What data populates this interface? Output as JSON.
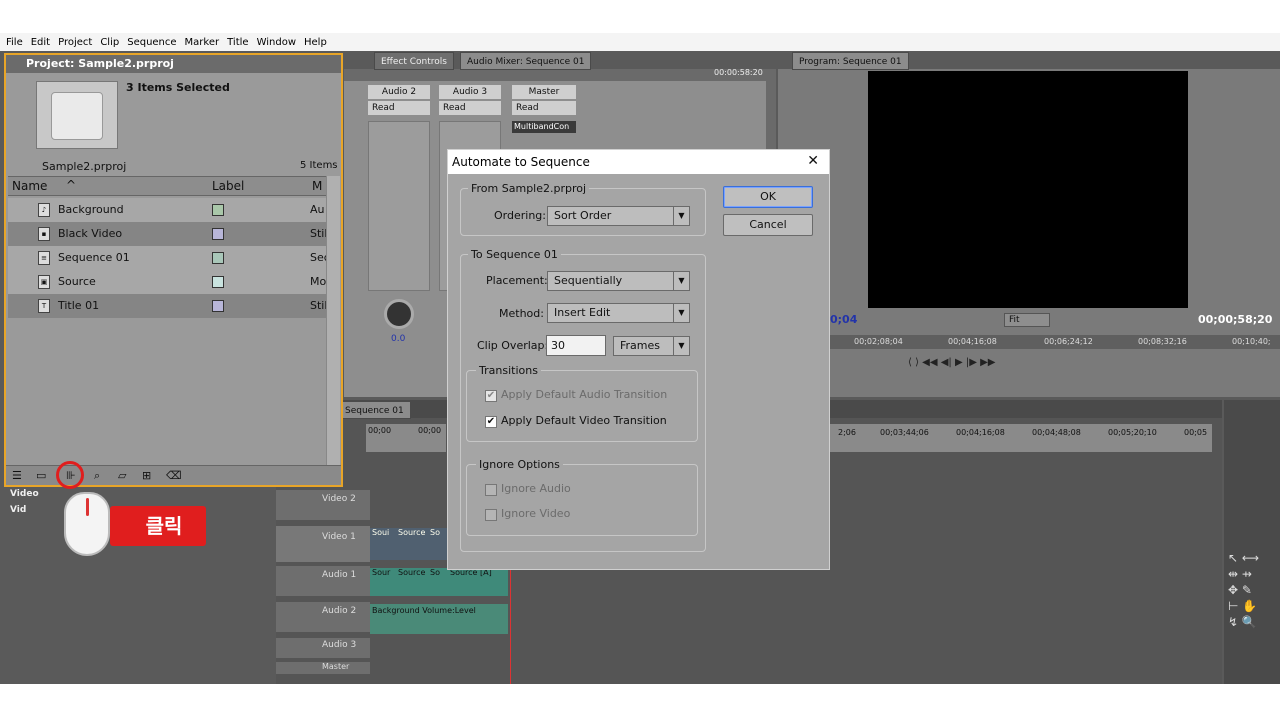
{
  "menu": [
    "File",
    "Edit",
    "Project",
    "Clip",
    "Sequence",
    "Marker",
    "Title",
    "Window",
    "Help"
  ],
  "tabs": {
    "effect_controls": "Effect Controls",
    "audio_mixer": "Audio Mixer: Sequence 01",
    "program": "Program: Sequence 01",
    "timeline": "Sequence 01"
  },
  "mixer": {
    "timecode": "00:00:58:20",
    "channels": [
      {
        "name": "Audio 2",
        "mode": "Read"
      },
      {
        "name": "Audio 3",
        "mode": "Read"
      },
      {
        "name": "Master",
        "mode": "Read"
      }
    ],
    "effect": "MultibandCon",
    "pan_value": "0.0"
  },
  "program": {
    "timecode_left": "0;04",
    "fit": "Fit",
    "timecode_right": "00;00;58;20",
    "ruler": [
      "00;02;08;04",
      "00;04;16;08",
      "00;06;24;12",
      "00;08;32;16",
      "00;10;40;"
    ]
  },
  "timeline": {
    "ruler_left": [
      "00;00",
      "00;00"
    ],
    "ruler_right": [
      "2;06",
      "00;03;44;06",
      "00;04;16;08",
      "00;04;48;08",
      "00;05;20;10",
      "00;05"
    ],
    "tracks": [
      "Video 2",
      "Video 1",
      "Audio 1",
      "Audio 2",
      "Audio 3",
      "Master"
    ],
    "clips_v1": [
      "Soui",
      "Source",
      "So"
    ],
    "clips_a1": [
      "Sour",
      "Source",
      "So",
      "Source [A]"
    ],
    "clip_a2": "Background Volume:Level"
  },
  "project": {
    "title": "Project: Sample2.prproj",
    "selection": "3 Items Selected",
    "file": "Sample2.prproj",
    "count": "5 Items",
    "columns": {
      "name": "Name",
      "label": "Label",
      "media": "M"
    },
    "items": [
      {
        "name": "Background",
        "media": "Au",
        "color": "#a9c7a9",
        "selected": false
      },
      {
        "name": "Black Video",
        "media": "Stil",
        "color": "#b8b6d8",
        "selected": true
      },
      {
        "name": "Sequence 01",
        "media": "Sec",
        "color": "#a9c7b9",
        "selected": false
      },
      {
        "name": "Source",
        "media": "Mo",
        "color": "#c9e3df",
        "selected": false
      },
      {
        "name": "Title 01",
        "media": "Stil",
        "color": "#b8b6d8",
        "selected": true
      }
    ],
    "bins": [
      "Video",
      "Vid"
    ]
  },
  "dialog": {
    "title": "Automate to Sequence",
    "from_group": "From Sample2.prproj",
    "ordering_label": "Ordering:",
    "ordering_value": "Sort Order",
    "to_group": "To Sequence 01",
    "placement_label": "Placement:",
    "placement_value": "Sequentially",
    "method_label": "Method:",
    "method_value": "Insert Edit",
    "overlap_label": "Clip Overlap:",
    "overlap_value": "30",
    "overlap_unit": "Frames",
    "transitions_group": "Transitions",
    "apply_audio": "Apply Default Audio Transition",
    "apply_video": "Apply Default Video Transition",
    "ignore_group": "Ignore Options",
    "ignore_audio": "Ignore Audio",
    "ignore_video": "Ignore Video",
    "ok": "OK",
    "cancel": "Cancel"
  },
  "annotation": {
    "click_label": "클릭"
  },
  "colors": {
    "highlight": "#e8a528",
    "annotation": "#e01e1e"
  }
}
